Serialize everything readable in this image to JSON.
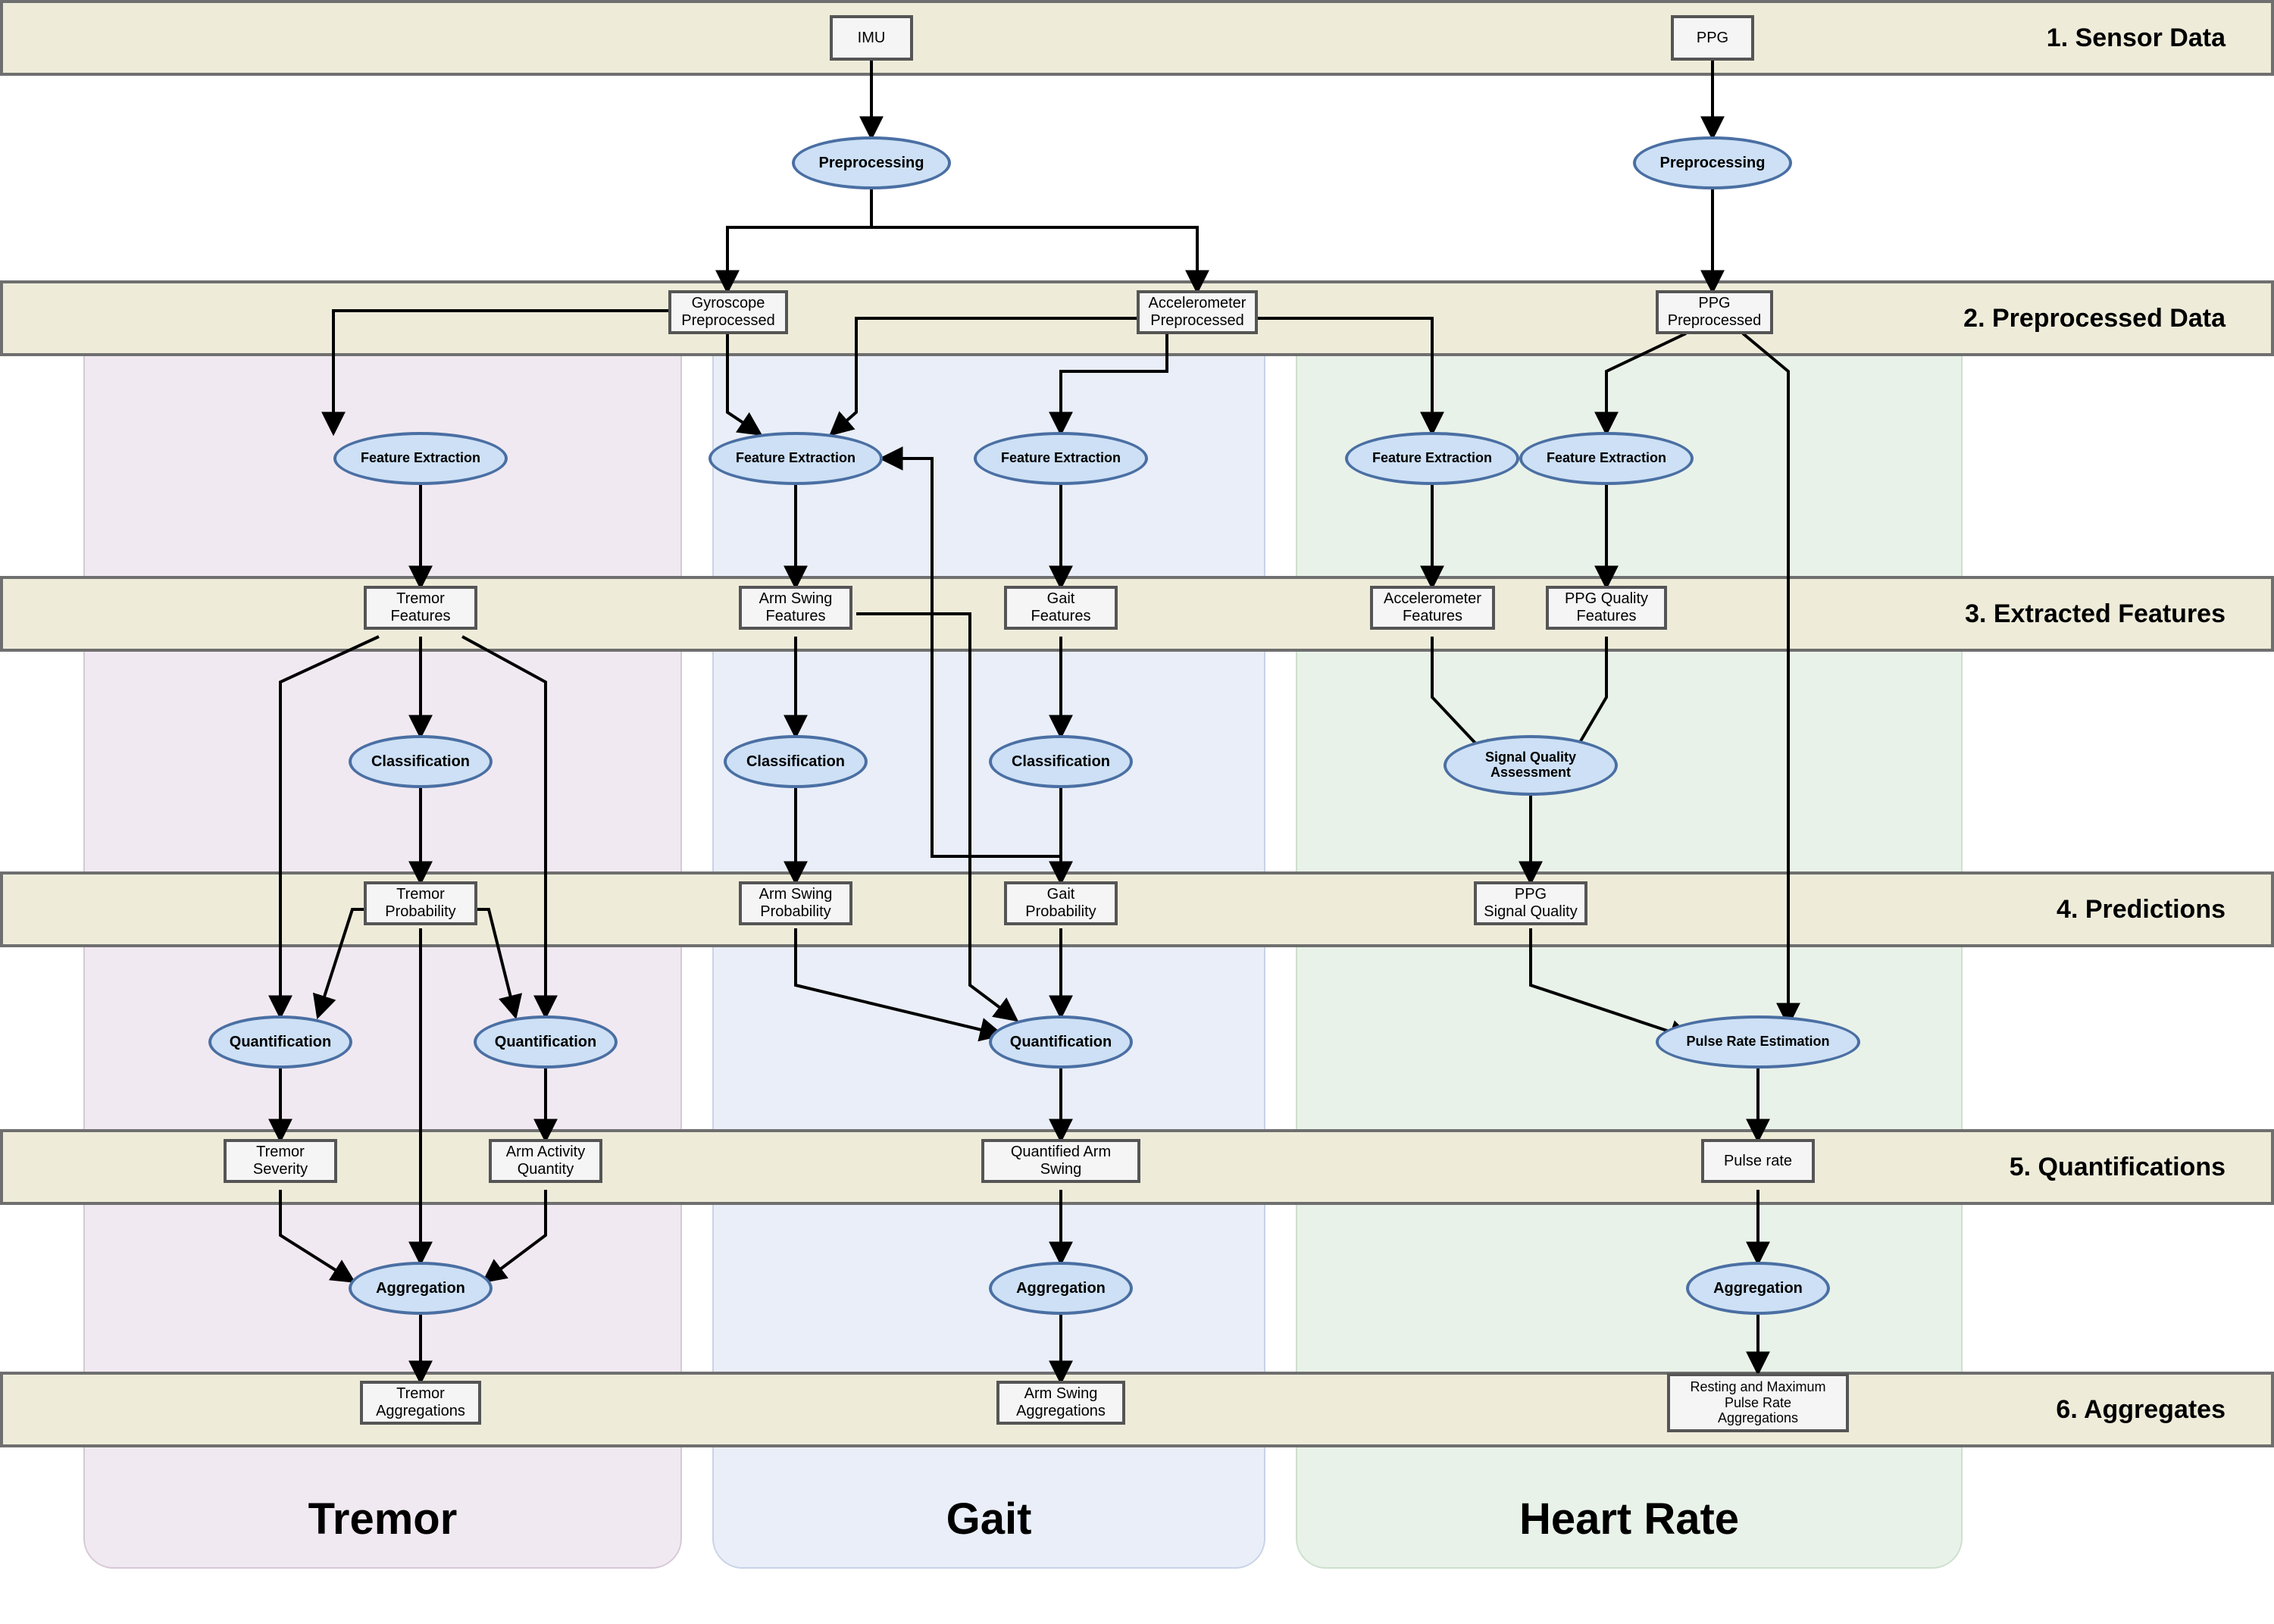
{
  "stages": {
    "s1": "1. Sensor Data",
    "s2": "2. Preprocessed Data",
    "s3": "3. Extracted Features",
    "s4": "4. Predictions",
    "s5": "5. Quantifications",
    "s6": "6. Aggregates"
  },
  "columns": {
    "tremor": "Tremor",
    "gait": "Gait",
    "hr": "Heart Rate"
  },
  "nodes": {
    "imu": "IMU",
    "ppg": "PPG",
    "preproc_imu": "Preprocessing",
    "preproc_ppg": "Preprocessing",
    "gyro_pre": "Gyroscope\nPreprocessed",
    "accel_pre": "Accelerometer\nPreprocessed",
    "ppg_pre": "PPG\nPreprocessed",
    "fe_tremor": "Feature Extraction",
    "fe_arm": "Feature Extraction",
    "fe_gait": "Feature Extraction",
    "fe_accel": "Feature Extraction",
    "fe_ppgq": "Feature Extraction",
    "tremor_feat": "Tremor\nFeatures",
    "arm_feat": "Arm Swing\nFeatures",
    "gait_feat": "Gait\nFeatures",
    "accel_feat": "Accelerometer\nFeatures",
    "ppgq_feat": "PPG Quality\nFeatures",
    "cls_tremor": "Classification",
    "cls_arm": "Classification",
    "cls_gait": "Classification",
    "sqa": "Signal Quality\nAssessment",
    "tremor_prob": "Tremor\nProbability",
    "arm_prob": "Arm Swing\nProbability",
    "gait_prob": "Gait\nProbability",
    "ppg_sq": "PPG\nSignal Quality",
    "quant_sev": "Quantification",
    "quant_act": "Quantification",
    "quant_arm": "Quantification",
    "pre": "Pulse Rate Estimation",
    "tremor_sev": "Tremor\nSeverity",
    "arm_act": "Arm Activity\nQuantity",
    "qarm": "Quantified Arm Swing",
    "prate": "Pulse rate",
    "agg_tremor": "Aggregation",
    "agg_gait": "Aggregation",
    "agg_hr": "Aggregation",
    "tremor_aggs": "Tremor\nAggregations",
    "arm_aggs": "Arm Swing\nAggregations",
    "hr_aggs": "Resting and Maximum\nPulse Rate\nAggregations"
  }
}
